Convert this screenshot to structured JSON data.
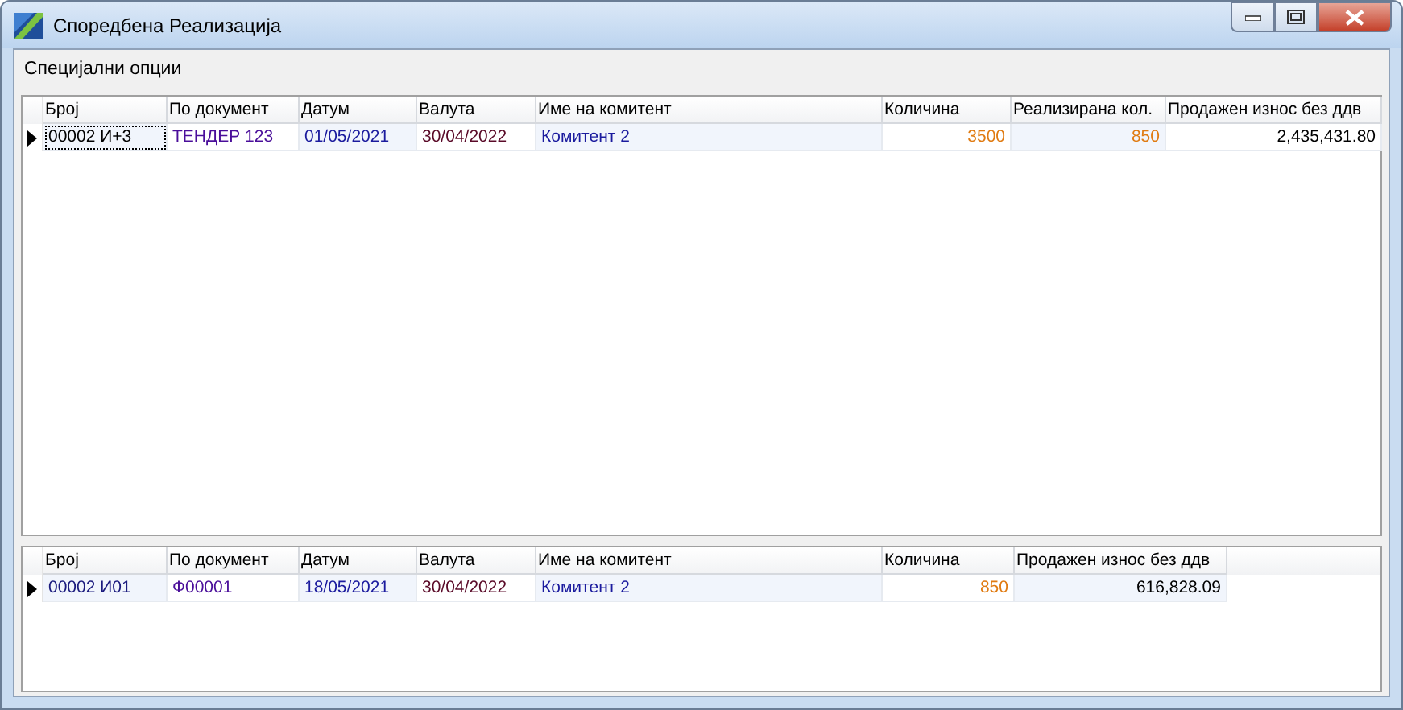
{
  "window": {
    "title": "Споредбена Реализација"
  },
  "menu": [
    "Специјални опции"
  ],
  "grids": [
    {
      "columns": [
        {
          "label": "Број",
          "kind": "id"
        },
        {
          "label": "По документ",
          "kind": "document"
        },
        {
          "label": "Датум",
          "kind": "date"
        },
        {
          "label": "Валута",
          "kind": "due"
        },
        {
          "label": "Име на комитент",
          "kind": "name"
        },
        {
          "label": "Количина",
          "kind": "quantity"
        },
        {
          "label": "Реализирана кол.",
          "kind": "quantity"
        },
        {
          "label": "Продажен износ без ддв",
          "kind": "amount"
        }
      ],
      "rows": [
        {
          "current": true,
          "first_cell_focused": true,
          "cells": [
            "00002  И+3",
            "ТЕНДЕР 123",
            "01/05/2021",
            "30/04/2022",
            "Комитент 2",
            "3500",
            "850",
            "2,435,431.80"
          ]
        }
      ]
    },
    {
      "columns": [
        {
          "label": "Број",
          "kind": "id"
        },
        {
          "label": "По документ",
          "kind": "document"
        },
        {
          "label": "Датум",
          "kind": "date"
        },
        {
          "label": "Валута",
          "kind": "due"
        },
        {
          "label": "Име на комитент",
          "kind": "name"
        },
        {
          "label": "Количина",
          "kind": "quantity"
        },
        {
          "label": "Продажен износ без ддв",
          "kind": "amount"
        }
      ],
      "rows": [
        {
          "current": true,
          "first_cell_focused": false,
          "cells": [
            "00002  И01",
            "Ф00001",
            "18/05/2021",
            "30/04/2022",
            "Комитент 2",
            "850",
            "616,828.09"
          ]
        }
      ]
    }
  ]
}
